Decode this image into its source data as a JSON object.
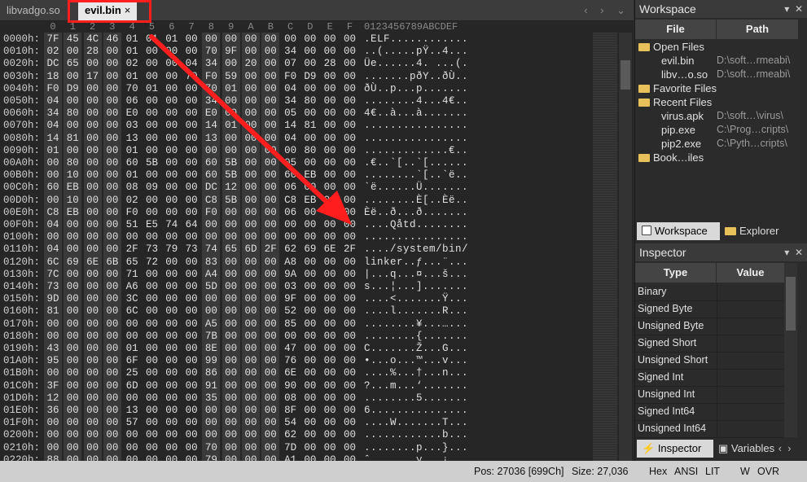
{
  "tabs": [
    {
      "label": "libvadgo.so",
      "active": false
    },
    {
      "label": "evil.bin",
      "active": true,
      "close": "×"
    }
  ],
  "tab_nav": "‹ › ⌄",
  "hex": {
    "column_headers": [
      "0",
      "1",
      "2",
      "3",
      "4",
      "5",
      "6",
      "7",
      "8",
      "9",
      "A",
      "B",
      "C",
      "D",
      "E",
      "F"
    ],
    "ascii_header": "0123456789ABCDEF",
    "rows": [
      {
        "off": "0000h:",
        "b": "7F 45 4C 46 01 01 01 00 00 00 00 00 00 00 00 00",
        "a": ".ELF............"
      },
      {
        "off": "0010h:",
        "b": "02 00 28 00 01 00 00 00 70 9F 00 00 34 00 00 00",
        "a": "..(.....pŸ..4..."
      },
      {
        "off": "0020h:",
        "b": "DC 65 00 00 02 00 00 04 34 00 20 00 07 00 28 00",
        "a": "Üe......4. ...(."
      },
      {
        "off": "0030h:",
        "b": "18 00 17 00 01 00 00 70 F0 59 00 00 F0 D9 00 00",
        "a": ".......pðY..ðÙ.."
      },
      {
        "off": "0040h:",
        "b": "F0 D9 00 00 70 01 00 00 70 01 00 00 04 00 00 00",
        "a": "ðÙ..p...p......."
      },
      {
        "off": "0050h:",
        "b": "04 00 00 00 06 00 00 00 34 00 00 00 34 80 00 00",
        "a": "........4...4€.."
      },
      {
        "off": "0060h:",
        "b": "34 80 00 00 E0 00 00 00 E0 00 00 00 05 00 00 00",
        "a": "4€..à...à......."
      },
      {
        "off": "0070h:",
        "b": "04 00 00 00 03 00 00 00 14 01 00 00 14 81 00 00",
        "a": "................"
      },
      {
        "off": "0080h:",
        "b": "14 81 00 00 13 00 00 00 13 00 00 00 04 00 00 00",
        "a": "................"
      },
      {
        "off": "0090h:",
        "b": "01 00 00 00 01 00 00 00 00 00 00 00 00 80 00 00",
        "a": ".............€.."
      },
      {
        "off": "00A0h:",
        "b": "00 80 00 00 60 5B 00 00 60 5B 00 00 05 00 00 00",
        "a": ".€..`[..`[......"
      },
      {
        "off": "00B0h:",
        "b": "00 10 00 00 01 00 00 00 60 5B 00 00 60 EB 00 00",
        "a": "........`[..`ë.."
      },
      {
        "off": "00C0h:",
        "b": "60 EB 00 00 08 09 00 00 DC 12 00 00 06 00 00 00",
        "a": "`ë......Ü......."
      },
      {
        "off": "00D0h:",
        "b": "00 10 00 00 02 00 00 00 C8 5B 00 00 C8 EB 00 00",
        "a": "........È[..Èë.."
      },
      {
        "off": "00E0h:",
        "b": "C8 EB 00 00 F0 00 00 00 F0 00 00 00 06 00 00 00",
        "a": "Èë..ð...ð......."
      },
      {
        "off": "00F0h:",
        "b": "04 00 00 00 51 E5 74 64 00 00 00 00 00 00 00 00",
        "a": "....Qåtd........"
      },
      {
        "off": "0100h:",
        "b": "00 00 00 00 00 00 00 00 00 00 00 00 00 00 00 00",
        "a": "................"
      },
      {
        "off": "0110h:",
        "b": "04 00 00 00 2F 73 79 73 74 65 6D 2F 62 69 6E 2F",
        "a": "..../system/bin/"
      },
      {
        "off": "0120h:",
        "b": "6C 69 6E 6B 65 72 00 00 83 00 00 00 A8 00 00 00",
        "a": "linker..ƒ...¨..."
      },
      {
        "off": "0130h:",
        "b": "7C 00 00 00 71 00 00 00 A4 00 00 00 9A 00 00 00",
        "a": "|...q...¤...š..."
      },
      {
        "off": "0140h:",
        "b": "73 00 00 00 A6 00 00 00 5D 00 00 00 03 00 00 00",
        "a": "s...¦...]......."
      },
      {
        "off": "0150h:",
        "b": "9D 00 00 00 3C 00 00 00 00 00 00 00 9F 00 00 00",
        "a": "....<.......Ÿ..."
      },
      {
        "off": "0160h:",
        "b": "81 00 00 00 6C 00 00 00 00 00 00 00 52 00 00 00",
        "a": "....l.......R..."
      },
      {
        "off": "0170h:",
        "b": "00 00 00 00 00 00 00 00 A5 00 00 00 85 00 00 00",
        "a": "........¥...…..."
      },
      {
        "off": "0180h:",
        "b": "00 00 00 00 00 00 00 00 7B 00 00 00 00 00 00 00",
        "a": "........{......."
      },
      {
        "off": "0190h:",
        "b": "43 00 00 00 01 00 00 00 8E 00 00 00 47 00 00 00",
        "a": "C.......Ž...G..."
      },
      {
        "off": "01A0h:",
        "b": "95 00 00 00 6F 00 00 00 99 00 00 00 76 00 00 00",
        "a": "•...o...™...v..."
      },
      {
        "off": "01B0h:",
        "b": "00 00 00 00 25 00 00 00 86 00 00 00 6E 00 00 00",
        "a": "....%...†...n..."
      },
      {
        "off": "01C0h:",
        "b": "3F 00 00 00 6D 00 00 00 91 00 00 00 90 00 00 00",
        "a": "?...m...‘......."
      },
      {
        "off": "01D0h:",
        "b": "12 00 00 00 00 00 00 00 35 00 00 00 08 00 00 00",
        "a": "........5......."
      },
      {
        "off": "01E0h:",
        "b": "36 00 00 00 13 00 00 00 00 00 00 00 8F 00 00 00",
        "a": "6..............."
      },
      {
        "off": "01F0h:",
        "b": "00 00 00 00 57 00 00 00 00 00 00 00 54 00 00 00",
        "a": "....W.......T..."
      },
      {
        "off": "0200h:",
        "b": "00 00 00 00 00 00 00 00 00 00 00 00 62 00 00 00",
        "a": "............b..."
      },
      {
        "off": "0210h:",
        "b": "00 00 00 00 00 00 00 00 70 00 00 00 7D 00 00 00",
        "a": "........p...}..."
      },
      {
        "off": "0220h:",
        "b": "88 00 00 00 00 00 00 00 79 00 00 00 A1 00 00 00",
        "a": "ˆ.......y...¡..."
      }
    ]
  },
  "status": {
    "pos": "Pos: 27036 [699Ch]",
    "size": "Size: 27,036",
    "hex": "Hex",
    "ansi": "ANSI",
    "lit": "LIT",
    "w": "W",
    "ovr": "OVR"
  },
  "workspace": {
    "title": "Workspace",
    "col_file": "File",
    "col_path": "Path",
    "items": [
      {
        "name": "Open Files",
        "path": "",
        "kind": "group"
      },
      {
        "name": "evil.bin",
        "path": "D:\\soft…rmeabi\\",
        "kind": "file"
      },
      {
        "name": "libv…o.so",
        "path": "D:\\soft…rmeabi\\",
        "kind": "file"
      },
      {
        "name": "Favorite Files",
        "path": "",
        "kind": "group"
      },
      {
        "name": "Recent Files",
        "path": "",
        "kind": "group"
      },
      {
        "name": "virus.apk",
        "path": "D:\\soft…\\virus\\",
        "kind": "file"
      },
      {
        "name": "pip.exe",
        "path": "C:\\Prog…cripts\\",
        "kind": "file"
      },
      {
        "name": "pip2.exe",
        "path": "C:\\Pyth…cripts\\",
        "kind": "file"
      },
      {
        "name": "Book…iles",
        "path": "",
        "kind": "group"
      }
    ],
    "tabs": [
      "Workspace",
      "Explorer"
    ]
  },
  "inspector": {
    "title": "Inspector",
    "col_type": "Type",
    "col_value": "Value",
    "rows": [
      "Binary",
      "Signed Byte",
      "Unsigned Byte",
      "Signed Short",
      "Unsigned Short",
      "Signed Int",
      "Unsigned Int",
      "Signed Int64",
      "Unsigned Int64"
    ],
    "tabs": [
      "Inspector",
      "Variables"
    ]
  },
  "colors": {
    "annotation": "#ff1e1e",
    "active_tab": "#e8e8e8"
  }
}
